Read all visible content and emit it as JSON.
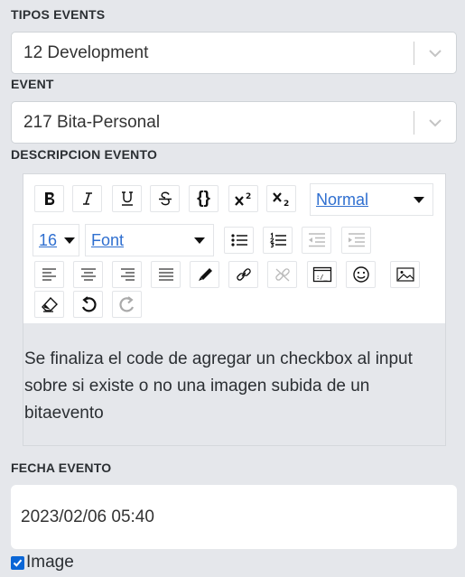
{
  "tipos_events": {
    "label": "TIPOS EVENTS",
    "value": "12 Development"
  },
  "event": {
    "label": "EVENT",
    "value": "217 Bita-Personal"
  },
  "descripcion": {
    "label": "DESCRIPCION EVENTO",
    "toolbar": {
      "header_select": "Normal",
      "size_select": "16",
      "font_select": "Font",
      "buttons": [
        "bold",
        "italic",
        "underline",
        "strike",
        "code",
        "superscript",
        "subscript",
        "bullet-list",
        "ordered-list",
        "outdent",
        "indent",
        "align-left",
        "align-center",
        "align-right",
        "justify",
        "color",
        "link",
        "unlink",
        "source",
        "emoji",
        "image",
        "clear-format",
        "undo",
        "redo"
      ]
    },
    "content_lines": [
      "Se finaliza el code de agregar un checkbox al input",
      "sobre si existe o no una imagen subida de  un",
      "bitaevento"
    ]
  },
  "fecha": {
    "label": "FECHA EVENTO",
    "value": "2023/02/06 05:40"
  },
  "image_checkbox": {
    "label": "Image",
    "checked": true
  }
}
